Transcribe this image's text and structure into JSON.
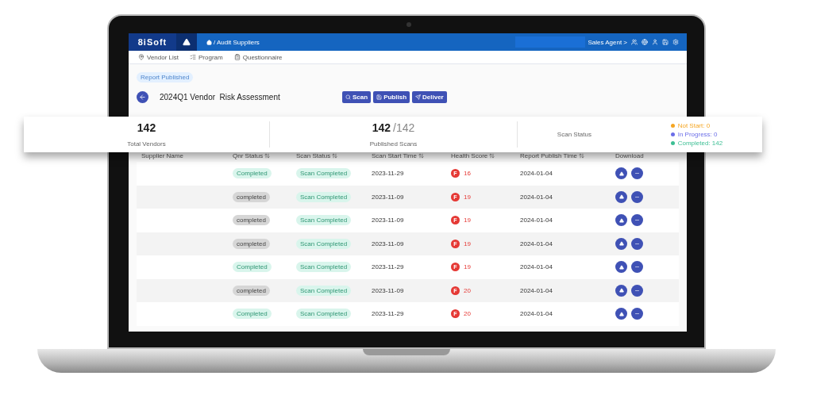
{
  "topbar": {
    "logo": "8iSoft",
    "breadcrumb": "/ Audit Suppliers",
    "user": "Sales Agent >"
  },
  "subnav": [
    {
      "label": "Vendor List"
    },
    {
      "label": "Program"
    },
    {
      "label": "Questionnaire"
    }
  ],
  "status_badge": "Report Published",
  "title": "2024Q1 Vendor  Risk Assessment",
  "actions": [
    {
      "label": "Scan"
    },
    {
      "label": "Publish"
    },
    {
      "label": "Deliver"
    }
  ],
  "summary": {
    "total": "142",
    "total_label": "Total Vendors",
    "published": "142",
    "published_total": "/142",
    "published_label": "Published Scans",
    "status_label": "Scan Status",
    "legend": [
      {
        "text": "Not Start: 0",
        "color": "#f5a623"
      },
      {
        "text": "In Progress: 0",
        "color": "#6b6ee8"
      },
      {
        "text": "Completed: 142",
        "color": "#3dbf94"
      }
    ]
  },
  "table": {
    "columns": [
      "Supplier Name",
      "Qnr Status",
      "Scan Status",
      "Scan Start Time",
      "Health Score",
      "Report Publish Time",
      "Download"
    ],
    "rows": [
      {
        "qnr": "Completed",
        "kind": "green",
        "scan": "Scan Completed",
        "start": "2023-11-29",
        "grade": "F",
        "score": "16",
        "publish": "2024-01-04"
      },
      {
        "qnr": "completed",
        "kind": "grey",
        "scan": "Scan Completed",
        "start": "2023-11-09",
        "grade": "F",
        "score": "19",
        "publish": "2024-01-04"
      },
      {
        "qnr": "completed",
        "kind": "grey",
        "scan": "Scan Completed",
        "start": "2023-11-09",
        "grade": "F",
        "score": "19",
        "publish": "2024-01-04"
      },
      {
        "qnr": "completed",
        "kind": "grey",
        "scan": "Scan Completed",
        "start": "2023-11-09",
        "grade": "F",
        "score": "19",
        "publish": "2024-01-04"
      },
      {
        "qnr": "Completed",
        "kind": "green",
        "scan": "Scan Completed",
        "start": "2023-11-29",
        "grade": "F",
        "score": "19",
        "publish": "2024-01-04"
      },
      {
        "qnr": "completed",
        "kind": "grey",
        "scan": "Scan Completed",
        "start": "2023-11-09",
        "grade": "F",
        "score": "20",
        "publish": "2024-01-04"
      },
      {
        "qnr": "Completed",
        "kind": "green",
        "scan": "Scan Completed",
        "start": "2023-11-29",
        "grade": "F",
        "score": "20",
        "publish": "2024-01-04"
      }
    ]
  }
}
